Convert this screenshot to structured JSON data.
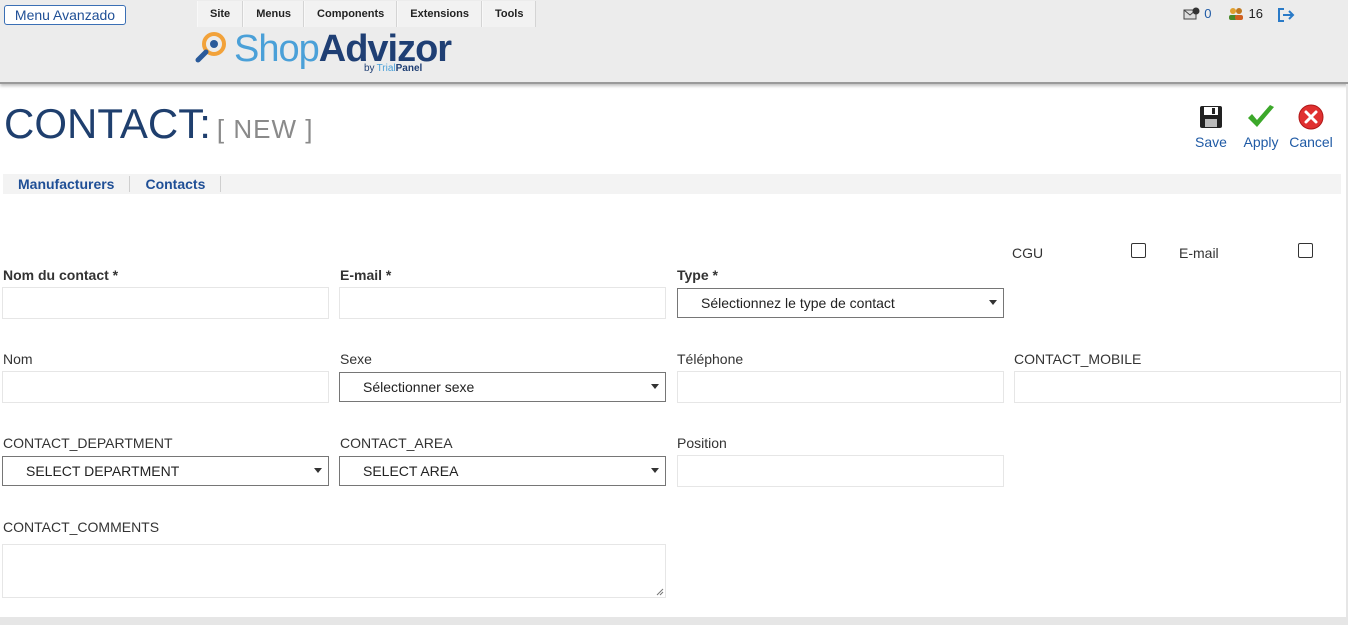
{
  "topbar": {
    "menu_button": "Menu Avanzado",
    "menu_items": [
      "Site",
      "Menus",
      "Components",
      "Extensions",
      "Tools"
    ],
    "status": {
      "messages_count": "0",
      "users_count": "16"
    }
  },
  "logo": {
    "shop": "Shop",
    "advizor": "Advizor",
    "by": "by",
    "trial": "Trial",
    "panel": "Panel"
  },
  "page": {
    "title": "CONTACT:",
    "subtitle": "[ NEW ]"
  },
  "toolbar": {
    "save": "Save",
    "apply": "Apply",
    "cancel": "Cancel"
  },
  "subnav": [
    "Manufacturers",
    "Contacts"
  ],
  "form": {
    "nom_contact_label": "Nom du contact *",
    "email_label": "E-mail *",
    "type_label": "Type *",
    "type_value": "Sélectionnez le type de contact",
    "cgu_label": "CGU",
    "email_check_label": "E-mail",
    "nom_label": "Nom",
    "sexe_label": "Sexe",
    "sexe_value": "Sélectionner sexe",
    "telephone_label": "Téléphone",
    "mobile_label": "CONTACT_MOBILE",
    "department_label": "CONTACT_DEPARTMENT",
    "department_value": "SELECT DEPARTMENT",
    "area_label": "CONTACT_AREA",
    "area_value": "SELECT AREA",
    "position_label": "Position",
    "comments_label": "CONTACT_COMMENTS"
  }
}
